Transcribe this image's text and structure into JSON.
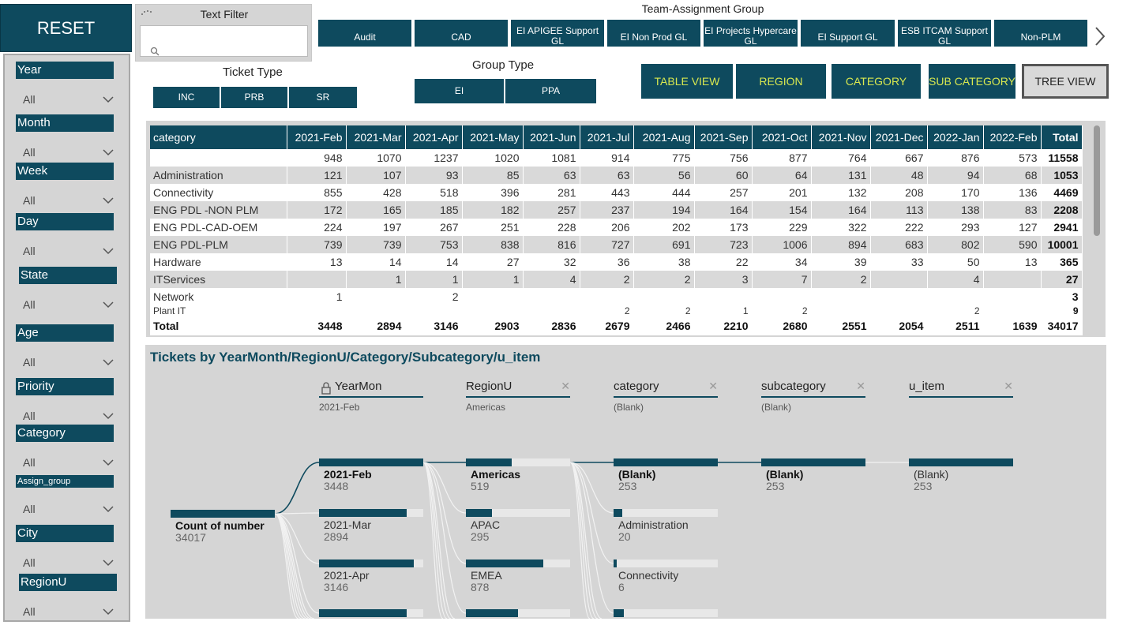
{
  "reset_label": "RESET",
  "slicers": [
    {
      "label": "Year",
      "value": "All"
    },
    {
      "label": "Month",
      "value": "All"
    },
    {
      "label": "Week",
      "value": "All"
    },
    {
      "label": "Day",
      "value": "All"
    },
    {
      "label": "State",
      "value": "All"
    },
    {
      "label": "Age",
      "value": "All"
    },
    {
      "label": "Priority",
      "value": "All"
    },
    {
      "label": "Category",
      "value": "All"
    },
    {
      "label": "Assign_group",
      "value": "All"
    },
    {
      "label": "City",
      "value": "All"
    },
    {
      "label": "RegionU",
      "value": "All"
    }
  ],
  "text_filter": {
    "title": "Text Filter",
    "placeholder": ""
  },
  "team_group": {
    "title": "Team-Assignment Group",
    "buttons": [
      "Audit",
      "CAD",
      "EI APIGEE Support GL",
      "EI Non Prod GL",
      "EI Projects Hypercare GL",
      "EI Support GL",
      "ESB ITCAM Support GL",
      "Non-PLM"
    ]
  },
  "ticket_type": {
    "title": "Ticket Type",
    "buttons": [
      "INC",
      "PRB",
      "SR"
    ]
  },
  "group_type": {
    "title": "Group Type",
    "buttons": [
      "EI",
      "PPA"
    ]
  },
  "views": [
    "TABLE VIEW",
    "REGION",
    "CATEGORY",
    "SUB CATEGORY",
    "TREE VIEW"
  ],
  "colors": {
    "primary": "#0e4a5e",
    "view_text": "#d9e84f",
    "panel": "#d5d5d5"
  },
  "matrix": {
    "headers": [
      "category",
      "2021-Feb",
      "2021-Mar",
      "2021-Apr",
      "2021-May",
      "2021-Jun",
      "2021-Jul",
      "2021-Aug",
      "2021-Sep",
      "2021-Oct",
      "2021-Nov",
      "2021-Dec",
      "2022-Jan",
      "2022-Feb",
      "Total"
    ],
    "rows": [
      [
        "",
        "948",
        "1070",
        "1237",
        "1020",
        "1081",
        "914",
        "775",
        "756",
        "877",
        "764",
        "667",
        "876",
        "573",
        "11558"
      ],
      [
        "Administration",
        "121",
        "107",
        "93",
        "85",
        "63",
        "63",
        "56",
        "60",
        "64",
        "131",
        "48",
        "94",
        "68",
        "1053"
      ],
      [
        "Connectivity",
        "855",
        "428",
        "518",
        "396",
        "281",
        "443",
        "444",
        "257",
        "201",
        "132",
        "208",
        "170",
        "136",
        "4469"
      ],
      [
        "ENG PDL -NON PLM",
        "172",
        "165",
        "185",
        "182",
        "257",
        "237",
        "194",
        "164",
        "154",
        "164",
        "113",
        "138",
        "83",
        "2208"
      ],
      [
        "ENG PDL-CAD-OEM",
        "224",
        "197",
        "267",
        "251",
        "228",
        "206",
        "202",
        "173",
        "229",
        "322",
        "222",
        "293",
        "127",
        "2941"
      ],
      [
        "ENG PDL-PLM",
        "739",
        "739",
        "753",
        "838",
        "816",
        "727",
        "691",
        "723",
        "1006",
        "894",
        "683",
        "802",
        "590",
        "10001"
      ],
      [
        "Hardware",
        "13",
        "14",
        "14",
        "27",
        "32",
        "36",
        "38",
        "22",
        "34",
        "39",
        "33",
        "50",
        "13",
        "365"
      ],
      [
        "ITServices",
        "",
        "1",
        "1",
        "1",
        "4",
        "2",
        "2",
        "3",
        "7",
        "2",
        "",
        "4",
        "",
        "27"
      ],
      [
        "Network",
        "1",
        "",
        "2",
        "",
        "",
        "",
        "",
        "",
        "",
        "",
        "",
        "",
        "",
        "3"
      ]
    ],
    "partial_row": [
      "Plant IT",
      "",
      "",
      "",
      "",
      "",
      "2",
      "2",
      "1",
      "2",
      "",
      "",
      "2",
      "",
      "9"
    ],
    "total": [
      "Total",
      "3448",
      "2894",
      "3146",
      "2903",
      "2836",
      "2679",
      "2466",
      "2210",
      "2680",
      "2551",
      "2054",
      "2511",
      "1639",
      "34017"
    ]
  },
  "tree": {
    "title": "Tickets by YearMonth/RegionU/Category/Subcategory/u_item",
    "levels": [
      {
        "name": "YearMon",
        "selected": "2021-Feb"
      },
      {
        "name": "RegionU",
        "selected": "Americas"
      },
      {
        "name": "category",
        "selected": "(Blank)"
      },
      {
        "name": "subcategory",
        "selected": "(Blank)"
      },
      {
        "name": "u_item",
        "selected": ""
      }
    ],
    "root": {
      "name": "Count of number",
      "value": "34017"
    },
    "yearmon": [
      {
        "name": "2021-Feb",
        "value": "3448",
        "fill": 1.0
      },
      {
        "name": "2021-Mar",
        "value": "2894",
        "fill": 0.84
      },
      {
        "name": "2021-Apr",
        "value": "3146",
        "fill": 0.91
      },
      {
        "name": "",
        "value": "",
        "fill": 0.84
      }
    ],
    "region": [
      {
        "name": "Americas",
        "value": "519",
        "fill": 0.44
      },
      {
        "name": "APAC",
        "value": "295",
        "fill": 0.25
      },
      {
        "name": "EMEA",
        "value": "878",
        "fill": 0.74
      },
      {
        "name": "",
        "value": "",
        "fill": 0.5
      }
    ],
    "category": [
      {
        "name": "(Blank)",
        "value": "253",
        "fill": 1.0
      },
      {
        "name": "Administration",
        "value": "20",
        "fill": 0.08
      },
      {
        "name": "Connectivity",
        "value": "6",
        "fill": 0.03
      },
      {
        "name": "",
        "value": "",
        "fill": 0.1
      }
    ],
    "subcategory": [
      {
        "name": "(Blank)",
        "value": "253",
        "fill": 1.0
      }
    ],
    "u_item": [
      {
        "name": "(Blank)",
        "value": "253",
        "fill": 1.0
      }
    ]
  }
}
